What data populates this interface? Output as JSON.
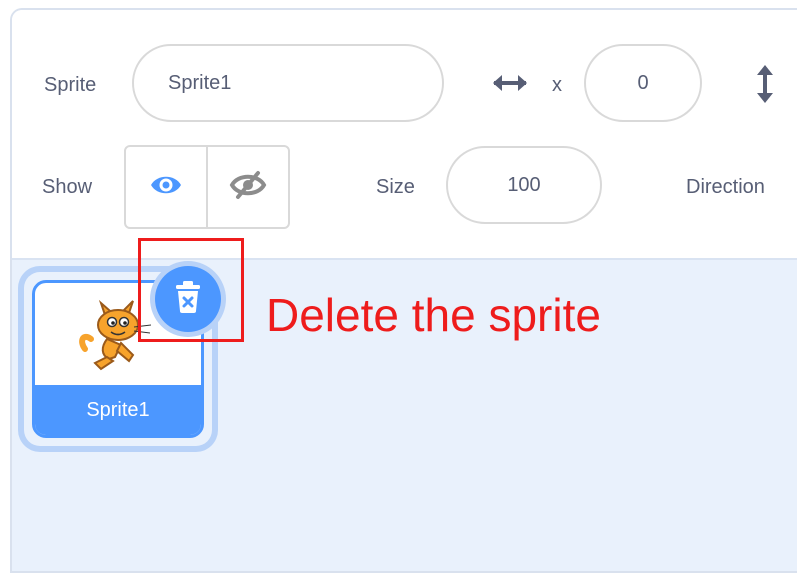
{
  "sprite_info": {
    "sprite_label": "Sprite",
    "sprite_name_value": "Sprite1",
    "x_label": "x",
    "x_value": "0",
    "show_label": "Show",
    "size_label": "Size",
    "size_value": "100",
    "direction_label": "Direction"
  },
  "sprite_list": {
    "items": [
      {
        "name": "Sprite1",
        "selected": true
      }
    ]
  },
  "annotation": {
    "text": "Delete the sprite"
  },
  "colors": {
    "accent": "#4c97ff",
    "annotation": "#ee1c1c",
    "text": "#575e75",
    "list_background": "#e9f1fc"
  },
  "icons": [
    "horizontal-arrows-icon",
    "vertical-arrows-icon",
    "eye-icon",
    "eye-off-icon",
    "trash-icon",
    "cat-sprite-icon"
  ]
}
